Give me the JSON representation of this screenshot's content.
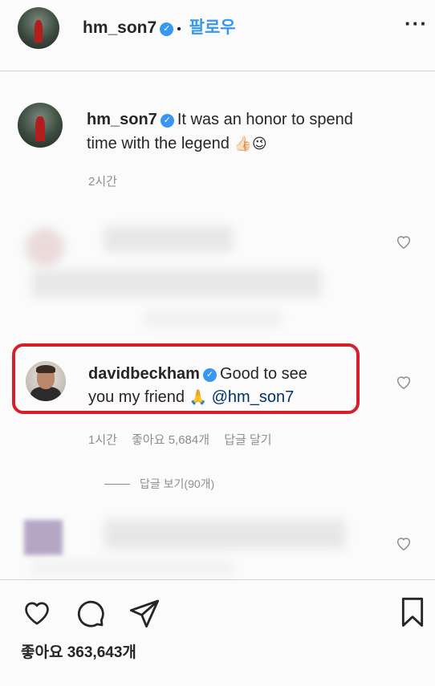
{
  "header": {
    "username": "hm_son7",
    "separator": "•",
    "follow_label": "팔로우",
    "more_icon": "more-dots-icon"
  },
  "caption": {
    "username": "hm_son7",
    "text_line1": "It was an honor to spend",
    "text_line2": "time with the legend",
    "emoji": "👍🏻😉",
    "time": "2시간"
  },
  "comment": {
    "username": "davidbeckham",
    "text_line1": "Good to see",
    "text_line2_prefix": "you my friend",
    "emoji": "🙏",
    "mention": "@hm_son7",
    "time": "1시간",
    "likes": "좋아요 5,684개",
    "reply_label": "답글 달기",
    "view_replies": "답글 보기(90개)",
    "highlight_color": "#d3202a"
  },
  "actions": {
    "like_icon": "heart-outline-icon",
    "comment_icon": "comment-bubble-icon",
    "share_icon": "paper-plane-icon",
    "save_icon": "bookmark-icon",
    "likes_count": "좋아요 363,643개"
  }
}
